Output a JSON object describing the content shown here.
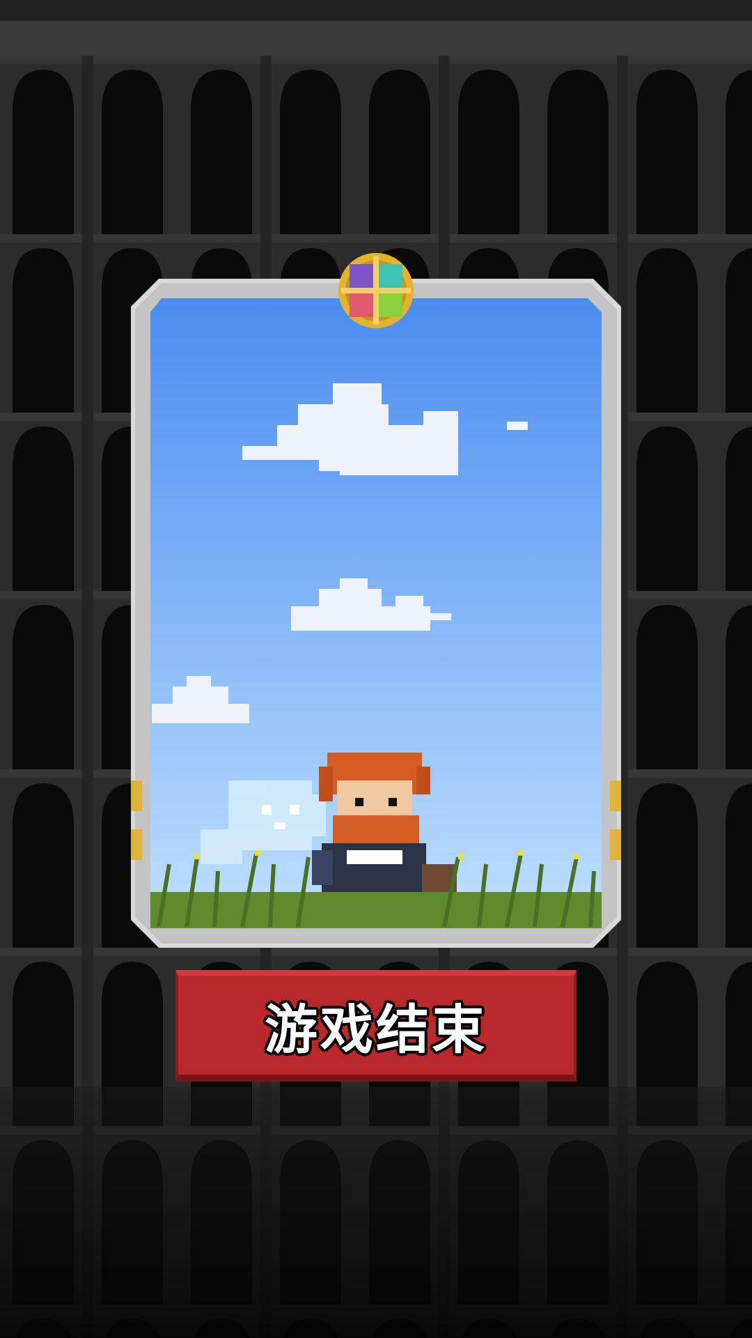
{
  "screen": {
    "button_label": "游戏结束"
  },
  "icons": {
    "emblem": "four-gem-gold-emblem-icon",
    "hero": "bearded-knight-hero-sprite",
    "ghost": "ghost-sprite",
    "side_coins": "gold-coin-icon"
  },
  "colors": {
    "background": "#151515",
    "wall": "#2b2b2b",
    "sky_top": "#4a8df0",
    "sky_bottom": "#bfe0ff",
    "frame": "#d8d8d8",
    "button": "#b9282a",
    "grass": "#5f8a2e"
  }
}
